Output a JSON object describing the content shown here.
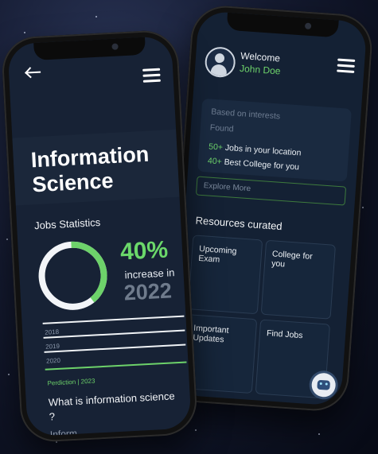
{
  "left_phone": {
    "title": "Information Science",
    "jobs_statistics": "Jobs Statistics",
    "percent": "40%",
    "percent_label": "increase in",
    "year": "2022",
    "progress": 0.4,
    "years": [
      "2018",
      "2019",
      "2020"
    ],
    "prediction": "Perdiction | 2023",
    "question": "What is information science ?",
    "partial_text": "Inform..."
  },
  "right_phone": {
    "welcome": "Welcome",
    "username": "John Doe",
    "based_on": "Based on interests",
    "found": "Found",
    "jobs_num": "50+",
    "jobs_text": "Jobs in your location",
    "college_num": "40+",
    "college_text": "Best College for you",
    "explore_placeholder": "Explore More",
    "resources_title": "Resources curated",
    "tiles": [
      {
        "label": "Upcoming Exam"
      },
      {
        "label": "College for you"
      },
      {
        "label": "Important Updates"
      },
      {
        "label": "Find Jobs"
      }
    ]
  },
  "colors": {
    "accent_green": "#6dd26a",
    "screen_bg": "#172235",
    "text_light": "#f3f5f8",
    "muted": "#6f7b8c"
  },
  "icons": [
    "back-arrow-icon",
    "menu-icon",
    "user-avatar-icon",
    "robot-assistant-icon"
  ]
}
